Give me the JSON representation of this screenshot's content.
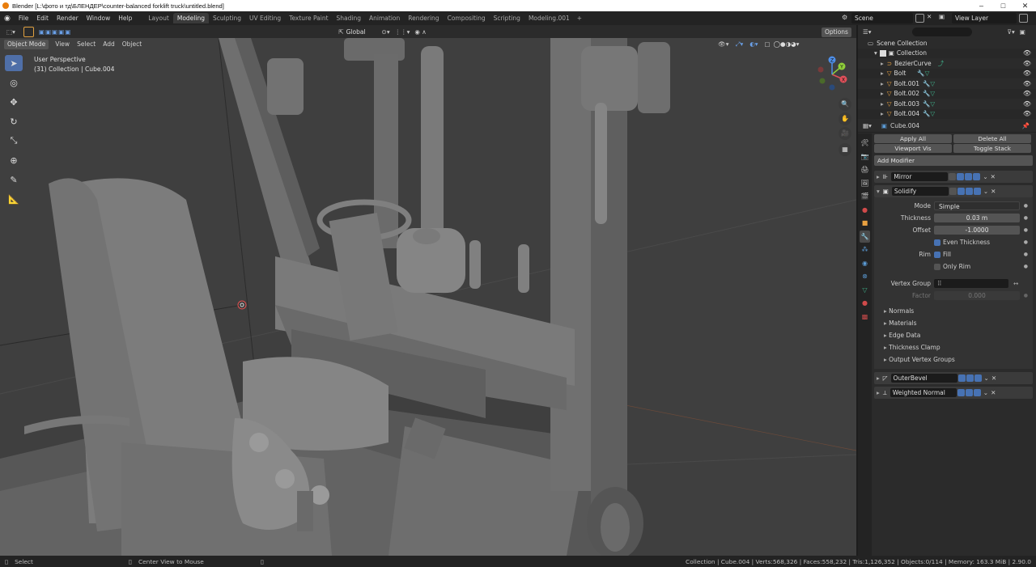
{
  "window": {
    "title": "Blender [L:\\фото и тд\\БЛЕНДЕР\\counter-balanced forklift truck\\untitled.blend]"
  },
  "menu": [
    "File",
    "Edit",
    "Render",
    "Window",
    "Help"
  ],
  "workspace_tabs": [
    {
      "label": "Layout",
      "active": false
    },
    {
      "label": "Modeling",
      "active": true
    },
    {
      "label": "Sculpting",
      "active": false
    },
    {
      "label": "UV Editing",
      "active": false
    },
    {
      "label": "Texture Paint",
      "active": false
    },
    {
      "label": "Shading",
      "active": false
    },
    {
      "label": "Animation",
      "active": false
    },
    {
      "label": "Rendering",
      "active": false
    },
    {
      "label": "Compositing",
      "active": false
    },
    {
      "label": "Scripting",
      "active": false
    },
    {
      "label": "Modeling.001",
      "active": false
    }
  ],
  "scene": {
    "name": "Scene",
    "view_layer": "View Layer"
  },
  "viewport": {
    "transform_orientation": "Global",
    "mode": "Object Mode",
    "menus": [
      "View",
      "Select",
      "Add",
      "Object"
    ],
    "options_label": "Options",
    "perspective_label": "User Perspective",
    "collection_info": "(31) Collection | Cube.004",
    "gizmo_axes": [
      "X",
      "Y",
      "Z"
    ]
  },
  "outliner": {
    "rows": [
      {
        "label": "Scene Collection",
        "icon": "scene-collection-icon"
      },
      {
        "label": "Collection",
        "icon": "collection-icon"
      },
      {
        "label": "BezierCurve",
        "icon": "curve-icon"
      },
      {
        "label": "Bolt",
        "icon": "mesh-icon"
      },
      {
        "label": "Bolt.001",
        "icon": "mesh-icon"
      },
      {
        "label": "Bolt.002",
        "icon": "mesh-icon"
      },
      {
        "label": "Bolt.003",
        "icon": "mesh-icon"
      },
      {
        "label": "Bolt.004",
        "icon": "mesh-icon"
      }
    ]
  },
  "properties": {
    "object_name": "Cube.004",
    "apply_all": "Apply All",
    "delete_all": "Delete All",
    "viewport_vis": "Viewport Vis",
    "toggle_stack": "Toggle Stack",
    "add_modifier": "Add Modifier",
    "modifiers": [
      "Mirror",
      "Solidify",
      "OuterBevel",
      "Weighted Normal"
    ],
    "solidify": {
      "mode_label": "Mode",
      "mode_value": "Simple",
      "thickness_label": "Thickness",
      "thickness_value": "0.03 m",
      "offset_label": "Offset",
      "offset_value": "-1.0000",
      "even_thickness": "Even Thickness",
      "rim_label": "Rim",
      "fill_label": "Fill",
      "only_rim": "Only Rim",
      "vertex_group_label": "Vertex Group",
      "factor_label": "Factor",
      "factor_value": "0.000",
      "subpanels": [
        "Normals",
        "Materials",
        "Edge Data",
        "Thickness Clamp",
        "Output Vertex Groups"
      ]
    }
  },
  "statusbar": {
    "select": "Select",
    "center_view": "Center View to Mouse",
    "stats": "Collection | Cube.004 | Verts:568,326 | Faces:558,232 | Tris:1,126,352 | Objects:0/114 | Memory: 163.3 MiB | 2.90.0"
  },
  "colors": {
    "accent": "#4772b3",
    "orange": "#e87d0d",
    "bg": "#3f3f3f"
  }
}
